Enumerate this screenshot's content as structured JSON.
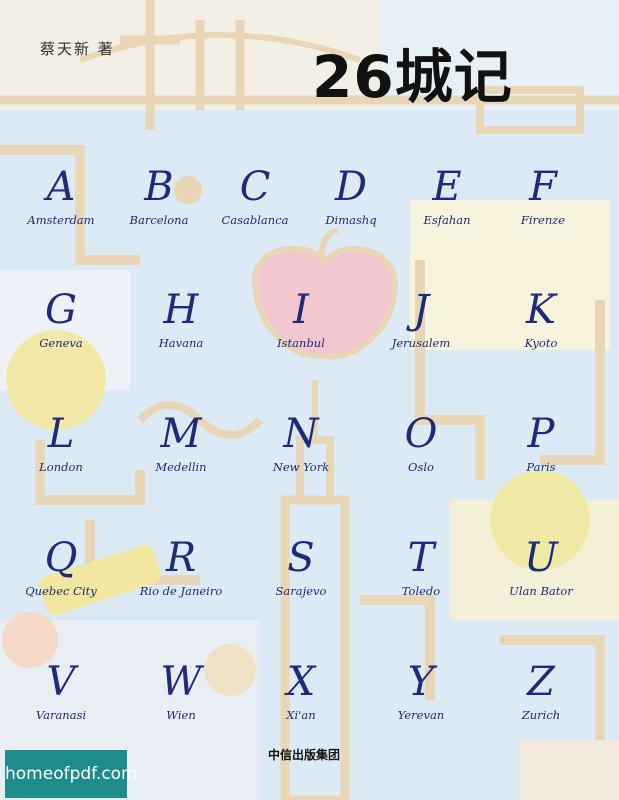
{
  "cover": {
    "author": "蔡天新 著",
    "title": "26城记",
    "publisher": "中信出版集团",
    "watermark": "homeofpdf.com",
    "accent_color": "#1e2b7a",
    "watermark_color": "#1f8c8c"
  },
  "cities": [
    {
      "letter": "A",
      "name": "Amsterdam"
    },
    {
      "letter": "B",
      "name": "Barcelona"
    },
    {
      "letter": "C",
      "name": "Casablanca"
    },
    {
      "letter": "D",
      "name": "Dimashq"
    },
    {
      "letter": "E",
      "name": "Esfahan"
    },
    {
      "letter": "F",
      "name": "Firenze"
    },
    {
      "letter": "G",
      "name": "Geneva"
    },
    {
      "letter": "H",
      "name": "Havana"
    },
    {
      "letter": "I",
      "name": "Istanbul"
    },
    {
      "letter": "J",
      "name": "Jerusalem"
    },
    {
      "letter": "K",
      "name": "Kyoto"
    },
    {
      "letter": "L",
      "name": "London"
    },
    {
      "letter": "M",
      "name": "Medellin"
    },
    {
      "letter": "N",
      "name": "New York"
    },
    {
      "letter": "O",
      "name": "Oslo"
    },
    {
      "letter": "P",
      "name": "Paris"
    },
    {
      "letter": "Q",
      "name": "Quebec City"
    },
    {
      "letter": "R",
      "name": "Rio de Janeiro"
    },
    {
      "letter": "S",
      "name": "Sarajevo"
    },
    {
      "letter": "T",
      "name": "Toledo"
    },
    {
      "letter": "U",
      "name": "Ulan Bator"
    },
    {
      "letter": "V",
      "name": "Varanasi"
    },
    {
      "letter": "W",
      "name": "Wien"
    },
    {
      "letter": "X",
      "name": "Xi'an"
    },
    {
      "letter": "Y",
      "name": "Yerevan"
    },
    {
      "letter": "Z",
      "name": "Zurich"
    }
  ]
}
